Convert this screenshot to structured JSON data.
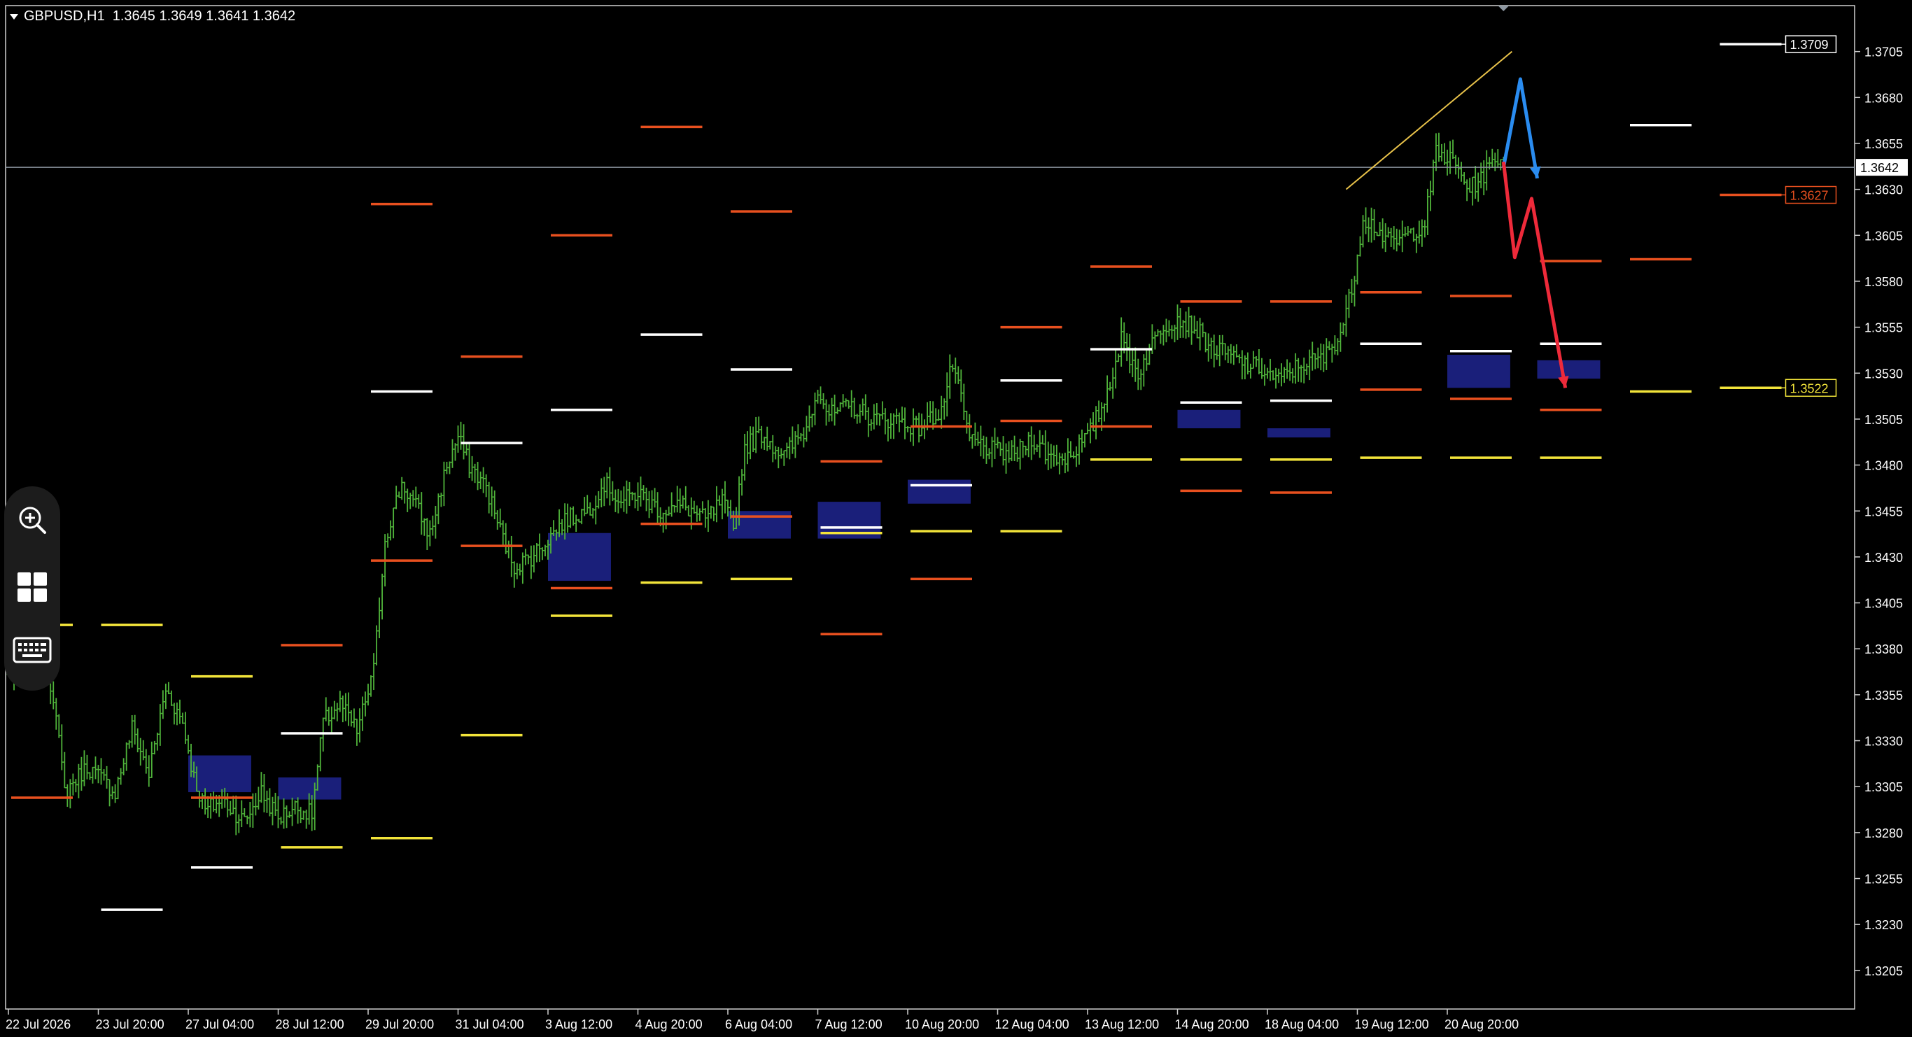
{
  "header": {
    "symbol": "GBPUSD,H1",
    "ohlc": "1.3645 1.3649 1.3641 1.3642"
  },
  "toolbar": [
    {
      "name": "zoom-in-button",
      "icon": "zoom-in-icon"
    },
    {
      "name": "tile-windows-button",
      "icon": "grid-icon"
    },
    {
      "name": "keyboard-button",
      "icon": "keyboard-icon"
    }
  ],
  "colors": {
    "background": "#000000",
    "grid": "#ffffff",
    "candle": "#4fb33a",
    "level_orange": "#e8501f",
    "level_white": "#ffffff",
    "level_yellow": "#f2e43a",
    "zone": "#1a1f7a",
    "bid_line": "#8c96a0",
    "arrow_blue": "#2a8cf0",
    "arrow_red": "#ee2a3a",
    "trend": "#e8c24a"
  },
  "chart_data": {
    "type": "line",
    "ylim": [
      1.3195,
      1.372
    ],
    "y_ticks": [
      "1.3705",
      "1.3680",
      "1.3655",
      "1.3630",
      "1.3605",
      "1.3580",
      "1.3555",
      "1.3530",
      "1.3505",
      "1.3480",
      "1.3455",
      "1.3430",
      "1.3405",
      "1.3380",
      "1.3355",
      "1.3330",
      "1.3305",
      "1.3280",
      "1.3255",
      "1.3230",
      "1.3205"
    ],
    "x_ticks": [
      "22 Jul 2026",
      "23 Jul 20:00",
      "27 Jul 04:00",
      "28 Jul 12:00",
      "29 Jul 20:00",
      "31 Jul 04:00",
      "3 Aug 12:00",
      "4 Aug 20:00",
      "6 Aug 04:00",
      "7 Aug 12:00",
      "10 Aug 20:00",
      "12 Aug 04:00",
      "13 Aug 12:00",
      "14 Aug 20:00",
      "18 Aug 04:00",
      "19 Aug 12:00",
      "20 Aug 20:00"
    ],
    "bars_per_tick": 32,
    "bid": "1.3642",
    "price_path": [
      [
        0,
        1.3365
      ],
      [
        6,
        1.3372
      ],
      [
        10,
        1.3395
      ],
      [
        16,
        1.3355
      ],
      [
        20,
        1.3302
      ],
      [
        28,
        1.3316
      ],
      [
        34,
        1.3308
      ],
      [
        38,
        1.3302
      ],
      [
        44,
        1.3337
      ],
      [
        50,
        1.3312
      ],
      [
        56,
        1.3358
      ],
      [
        62,
        1.334
      ],
      [
        66,
        1.331
      ],
      [
        70,
        1.3292
      ],
      [
        76,
        1.3298
      ],
      [
        84,
        1.3286
      ],
      [
        90,
        1.3302
      ],
      [
        96,
        1.3288
      ],
      [
        102,
        1.3294
      ],
      [
        108,
        1.329
      ],
      [
        112,
        1.334
      ],
      [
        118,
        1.335
      ],
      [
        124,
        1.3335
      ],
      [
        130,
        1.3368
      ],
      [
        134,
        1.344
      ],
      [
        140,
        1.347
      ],
      [
        146,
        1.3455
      ],
      [
        150,
        1.3442
      ],
      [
        156,
        1.348
      ],
      [
        160,
        1.3495
      ],
      [
        164,
        1.348
      ],
      [
        170,
        1.3468
      ],
      [
        176,
        1.344
      ],
      [
        180,
        1.3425
      ],
      [
        186,
        1.343
      ],
      [
        192,
        1.344
      ],
      [
        198,
        1.345
      ],
      [
        206,
        1.3455
      ],
      [
        212,
        1.347
      ],
      [
        218,
        1.346
      ],
      [
        224,
        1.3465
      ],
      [
        232,
        1.3455
      ],
      [
        240,
        1.3458
      ],
      [
        248,
        1.345
      ],
      [
        254,
        1.346
      ],
      [
        258,
        1.3445
      ],
      [
        262,
        1.349
      ],
      [
        268,
        1.3497
      ],
      [
        276,
        1.3485
      ],
      [
        284,
        1.35
      ],
      [
        288,
        1.3523
      ],
      [
        292,
        1.3507
      ],
      [
        300,
        1.3512
      ],
      [
        308,
        1.3505
      ],
      [
        316,
        1.3505
      ],
      [
        324,
        1.35
      ],
      [
        332,
        1.351
      ],
      [
        336,
        1.3535
      ],
      [
        342,
        1.3494
      ],
      [
        350,
        1.3488
      ],
      [
        358,
        1.3485
      ],
      [
        364,
        1.3495
      ],
      [
        370,
        1.3485
      ],
      [
        376,
        1.3484
      ],
      [
        384,
        1.3495
      ],
      [
        390,
        1.3515
      ],
      [
        396,
        1.3548
      ],
      [
        402,
        1.353
      ],
      [
        410,
        1.3555
      ],
      [
        416,
        1.356
      ],
      [
        422,
        1.3555
      ],
      [
        428,
        1.3544
      ],
      [
        434,
        1.354
      ],
      [
        440,
        1.3535
      ],
      [
        446,
        1.3532
      ],
      [
        452,
        1.3526
      ],
      [
        460,
        1.3535
      ],
      [
        468,
        1.3538
      ],
      [
        474,
        1.3552
      ],
      [
        478,
        1.3575
      ],
      [
        482,
        1.3615
      ],
      [
        486,
        1.361
      ],
      [
        492,
        1.36
      ],
      [
        498,
        1.3605
      ],
      [
        504,
        1.3612
      ],
      [
        508,
        1.365
      ],
      [
        514,
        1.3645
      ],
      [
        520,
        1.363
      ],
      [
        526,
        1.364
      ],
      [
        530,
        1.3648
      ],
      [
        532,
        1.3642
      ]
    ],
    "levels": {
      "orange": [
        [
          0.0,
          1.3299
        ],
        [
          1.0,
          1.3299
        ],
        [
          1.5,
          1.3382
        ],
        [
          2.0,
          1.3622
        ],
        [
          2.0,
          1.3428
        ],
        [
          2.5,
          1.3539
        ],
        [
          2.5,
          1.3436
        ],
        [
          3.0,
          1.3605
        ],
        [
          3.0,
          1.3413
        ],
        [
          3.5,
          1.3664
        ],
        [
          3.5,
          1.3448
        ],
        [
          4.0,
          1.3618
        ],
        [
          4.0,
          1.3452
        ],
        [
          4.5,
          1.3482
        ],
        [
          4.5,
          1.3388
        ],
        [
          5.0,
          1.3501
        ],
        [
          5.0,
          1.3418
        ],
        [
          5.5,
          1.3555
        ],
        [
          5.5,
          1.3504
        ],
        [
          6.0,
          1.3588
        ],
        [
          6.0,
          1.3501
        ],
        [
          6.5,
          1.3569
        ],
        [
          6.5,
          1.3466
        ],
        [
          7.0,
          1.3569
        ],
        [
          7.0,
          1.3465
        ],
        [
          7.5,
          1.3574
        ],
        [
          7.5,
          1.3521
        ],
        [
          8.0,
          1.3572
        ],
        [
          8.0,
          1.3516
        ],
        [
          8.5,
          1.3591
        ],
        [
          8.5,
          1.351
        ],
        [
          9.0,
          1.3592
        ],
        [
          9.5,
          1.3627
        ]
      ],
      "white": [
        [
          0.5,
          1.3238
        ],
        [
          1.0,
          1.3261
        ],
        [
          1.5,
          1.3334
        ],
        [
          2.0,
          1.352
        ],
        [
          2.5,
          1.3492
        ],
        [
          3.0,
          1.351
        ],
        [
          3.5,
          1.3551
        ],
        [
          4.0,
          1.3532
        ],
        [
          4.5,
          1.3446
        ],
        [
          5.0,
          1.3469
        ],
        [
          5.5,
          1.3526
        ],
        [
          6.0,
          1.3543
        ],
        [
          6.5,
          1.3514
        ],
        [
          7.0,
          1.3515
        ],
        [
          7.5,
          1.3546
        ],
        [
          8.0,
          1.3542
        ],
        [
          8.5,
          1.3546
        ],
        [
          9.0,
          1.3665
        ],
        [
          9.5,
          1.3709
        ]
      ],
      "yellow": [
        [
          -1.0,
          1.3457
        ],
        [
          -0.5,
          1.3395
        ],
        [
          0.0,
          1.3393
        ],
        [
          0.5,
          1.3393
        ],
        [
          1.0,
          1.3365
        ],
        [
          1.5,
          1.3272
        ],
        [
          2.0,
          1.3277
        ],
        [
          2.5,
          1.3333
        ],
        [
          3.0,
          1.3398
        ],
        [
          3.5,
          1.3416
        ],
        [
          4.0,
          1.3418
        ],
        [
          4.5,
          1.3443
        ],
        [
          5.0,
          1.3444
        ],
        [
          5.5,
          1.3444
        ],
        [
          6.0,
          1.3483
        ],
        [
          6.5,
          1.3483
        ],
        [
          7.0,
          1.3483
        ],
        [
          7.5,
          1.3484
        ],
        [
          8.0,
          1.3484
        ],
        [
          8.5,
          1.3484
        ],
        [
          9.0,
          1.352
        ],
        [
          9.5,
          1.3522
        ]
      ]
    },
    "zones": [
      [
        1.0,
        1.3302,
        1.3322
      ],
      [
        1.5,
        1.3298,
        1.331
      ],
      [
        3.0,
        1.3417,
        1.3443
      ],
      [
        4.0,
        1.344,
        1.3455
      ],
      [
        4.5,
        1.344,
        1.346
      ],
      [
        5.0,
        1.3459,
        1.3472
      ],
      [
        6.5,
        1.35,
        1.351
      ],
      [
        7.0,
        1.3495,
        1.35
      ],
      [
        8.0,
        1.3522,
        1.354
      ],
      [
        8.5,
        1.3527,
        1.3537
      ]
    ],
    "price_labels": [
      {
        "value": "1.3709",
        "color": "#ffffff"
      },
      {
        "value": "1.3627",
        "color": "#e8501f"
      },
      {
        "value": "1.3522",
        "color": "#f2e43a"
      }
    ]
  }
}
